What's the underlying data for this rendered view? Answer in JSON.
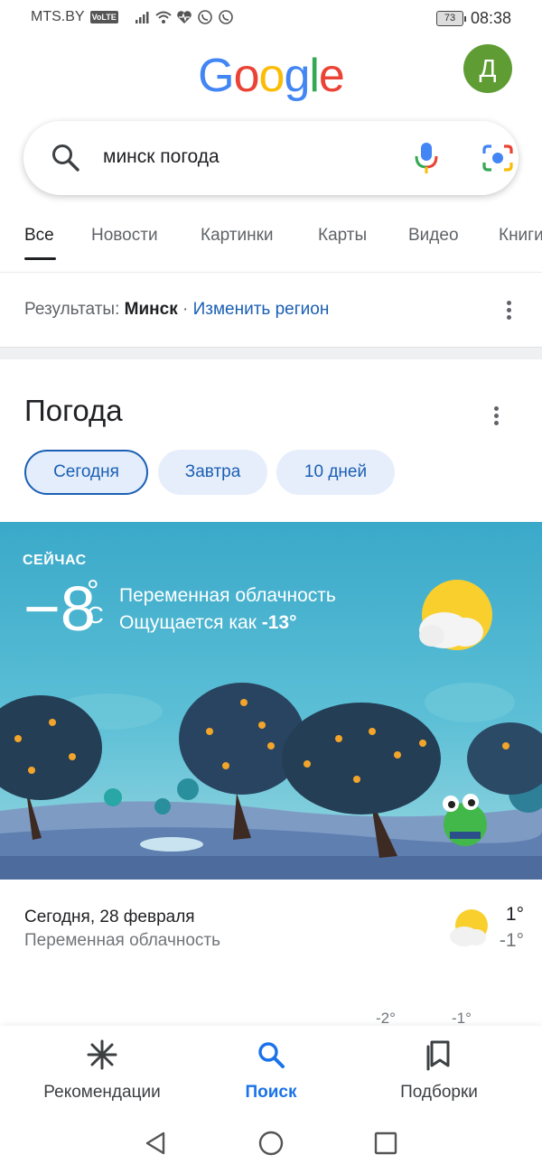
{
  "status_bar": {
    "carrier": "MTS.BY",
    "volte": "VoLTE",
    "battery": "73",
    "time": "08:38"
  },
  "header": {
    "logo_letters": [
      "G",
      "o",
      "o",
      "g",
      "l",
      "e"
    ],
    "logo_colors": [
      "#4285F4",
      "#EA4335",
      "#FBBC05",
      "#4285F4",
      "#34A853",
      "#EA4335"
    ],
    "avatar_letter": "Д",
    "avatar_color": "#5f9d34"
  },
  "search": {
    "query": "минск погода"
  },
  "tabs": [
    "Все",
    "Новости",
    "Картинки",
    "Карты",
    "Видео",
    "Книги"
  ],
  "region": {
    "prefix": "Результаты:",
    "city": "Минск",
    "separator": "·",
    "change_link": "Изменить регион"
  },
  "weather": {
    "title": "Погода",
    "chips": [
      "Сегодня",
      "Завтра",
      "10 дней"
    ],
    "now_label": "СЕЙЧАС",
    "temperature": "−8",
    "degree": "°",
    "unit": "C",
    "condition": "Переменная облачность",
    "feels_like_prefix": "Ощущается как",
    "feels_like_value": "-13°",
    "today_date": "Сегодня, 28 февраля",
    "today_condition": "Переменная облачность",
    "today_high": "1°",
    "today_low": "-1°",
    "peek_values": [
      "-2°",
      "-1°"
    ]
  },
  "bottom_nav": {
    "items": [
      {
        "label": "Рекомендации",
        "icon": "asterisk-icon"
      },
      {
        "label": "Поиск",
        "icon": "search-icon"
      },
      {
        "label": "Подборки",
        "icon": "collections-icon"
      }
    ],
    "active_color": "#1a73e8"
  }
}
